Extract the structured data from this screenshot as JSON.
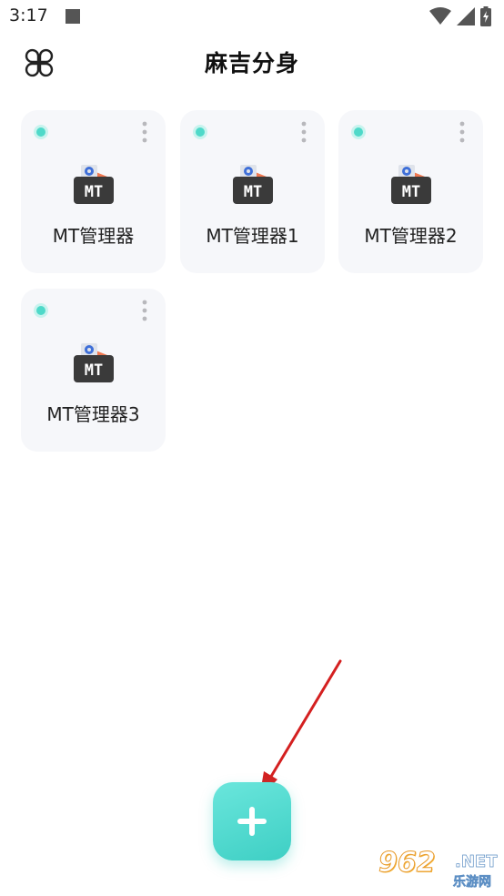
{
  "status_bar": {
    "time": "3:17",
    "icons": [
      "notification-square-icon",
      "wifi-icon",
      "signal-icon",
      "battery-charging-icon"
    ]
  },
  "header": {
    "title": "麻吉分身",
    "menu_icon": "clover-grid-icon"
  },
  "apps": [
    {
      "label": "MT管理器",
      "icon": "mt-manager-icon",
      "status_dot": "active"
    },
    {
      "label": "MT管理器1",
      "icon": "mt-manager-icon",
      "status_dot": "active"
    },
    {
      "label": "MT管理器2",
      "icon": "mt-manager-icon",
      "status_dot": "active"
    },
    {
      "label": "MT管理器3",
      "icon": "mt-manager-icon",
      "status_dot": "active"
    }
  ],
  "add_button": {
    "icon": "plus-icon"
  },
  "annotation": {
    "icon": "red-arrow-icon"
  },
  "watermark": {
    "main": "962",
    "net": ".NET",
    "sub": "乐游网"
  },
  "colors": {
    "accent": "#4fd9c9",
    "card_background": "#f6f7fa",
    "arrow": "#d42020",
    "mt_icon_dark": "#3a3a3a",
    "mt_icon_orange": "#f07850"
  }
}
